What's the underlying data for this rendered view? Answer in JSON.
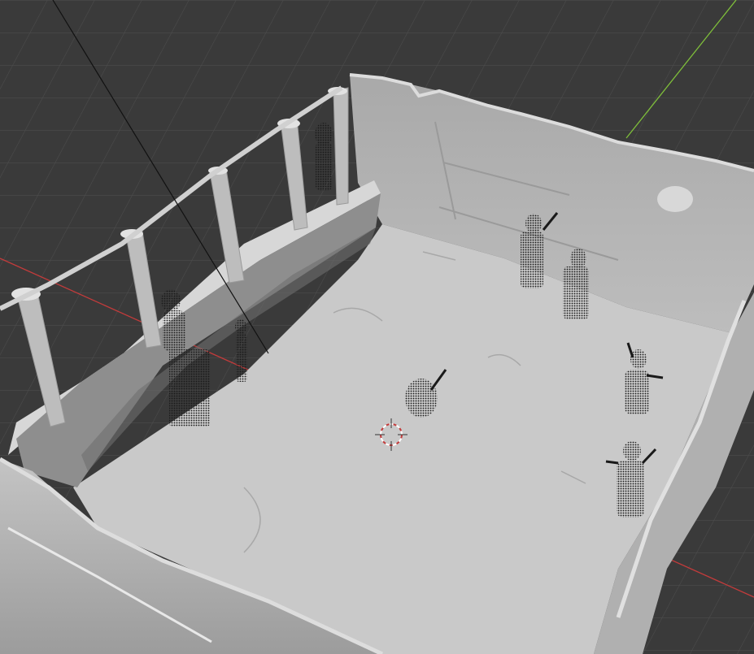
{
  "viewport": {
    "background": "#3a3a3a",
    "grid_color": "#4d4d4d",
    "x_axis_color": "#c23b3b",
    "y_axis_color": "#7fbf3a",
    "mesh_color": "#b9b9b9",
    "floor_color": "#c9c9c9",
    "point_cloud_color": "#1a1a1a",
    "cursor_icon": "3d-cursor-icon"
  }
}
